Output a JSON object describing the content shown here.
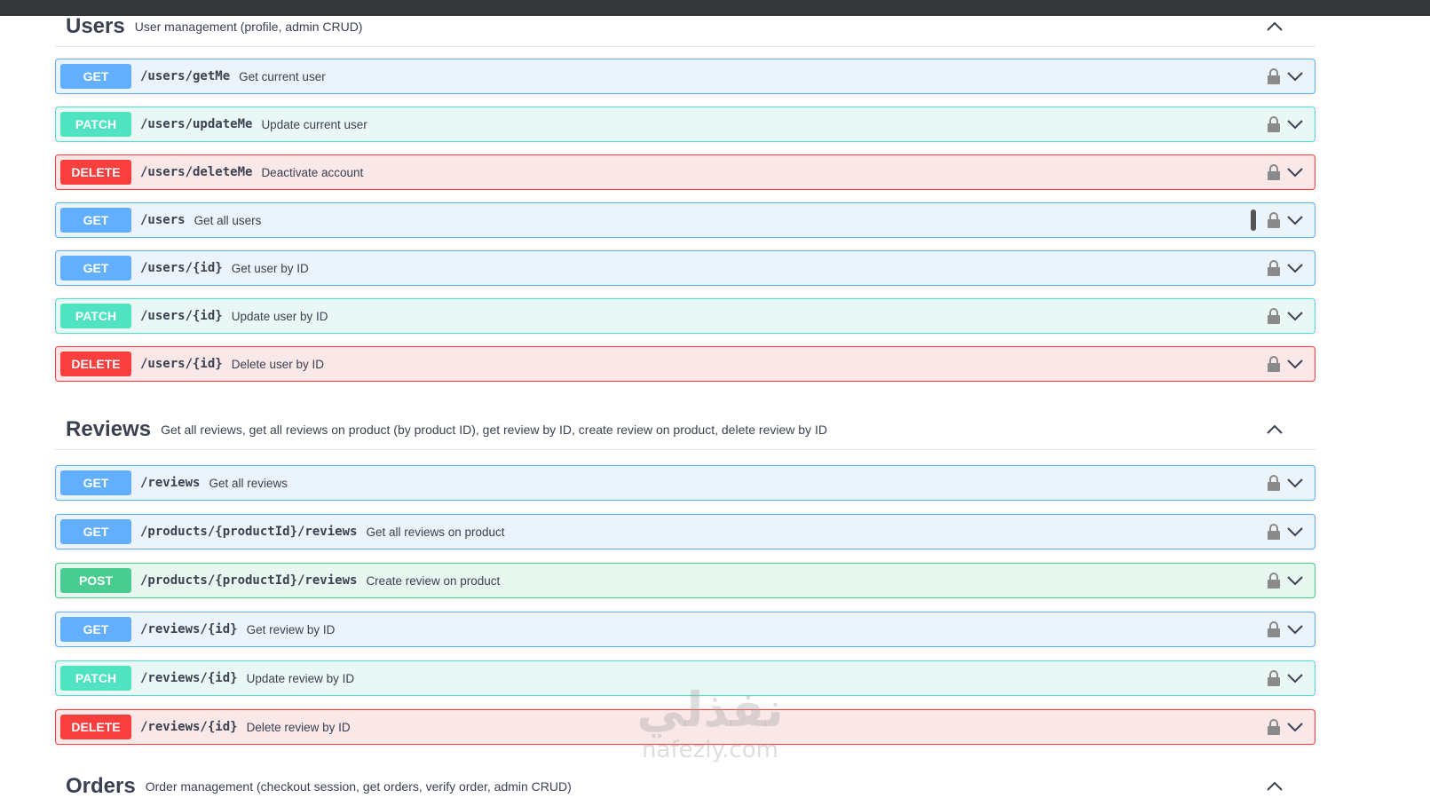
{
  "sections": [
    {
      "name": "Users",
      "description": "User management (profile, admin CRUD)",
      "operations": [
        {
          "method": "GET",
          "path": "/users/getMe",
          "summary": "Get current user"
        },
        {
          "method": "PATCH",
          "path": "/users/updateMe",
          "summary": "Update current user"
        },
        {
          "method": "DELETE",
          "path": "/users/deleteMe",
          "summary": "Deactivate account"
        },
        {
          "method": "GET",
          "path": "/users",
          "summary": "Get all users"
        },
        {
          "method": "GET",
          "path": "/users/{id}",
          "summary": "Get user by ID"
        },
        {
          "method": "PATCH",
          "path": "/users/{id}",
          "summary": "Update user by ID"
        },
        {
          "method": "DELETE",
          "path": "/users/{id}",
          "summary": "Delete user by ID"
        }
      ]
    },
    {
      "name": "Reviews",
      "description": "Get all reviews, get all reviews on product (by product ID), get review by ID, create review on product, delete review by ID",
      "operations": [
        {
          "method": "GET",
          "path": "/reviews",
          "summary": "Get all reviews"
        },
        {
          "method": "GET",
          "path": "/products/{productId}/reviews",
          "summary": "Get all reviews on product"
        },
        {
          "method": "POST",
          "path": "/products/{productId}/reviews",
          "summary": "Create review on product"
        },
        {
          "method": "GET",
          "path": "/reviews/{id}",
          "summary": "Get review by ID"
        },
        {
          "method": "PATCH",
          "path": "/reviews/{id}",
          "summary": "Update review by ID"
        },
        {
          "method": "DELETE",
          "path": "/reviews/{id}",
          "summary": "Delete review by ID"
        }
      ]
    },
    {
      "name": "Orders",
      "description": "Order management (checkout session, get orders, verify order, admin CRUD)",
      "operations": []
    }
  ],
  "watermark": {
    "arabic": "نفذلي",
    "latin": "nafezly.com"
  },
  "icons": {
    "lock": "lock-icon",
    "expand": "chevron-down-icon",
    "collapse": "chevron-up-icon"
  },
  "colors": {
    "GET": "#61affe",
    "PATCH": "#50e3c2",
    "DELETE": "#f93e3e",
    "POST": "#49cc90"
  }
}
